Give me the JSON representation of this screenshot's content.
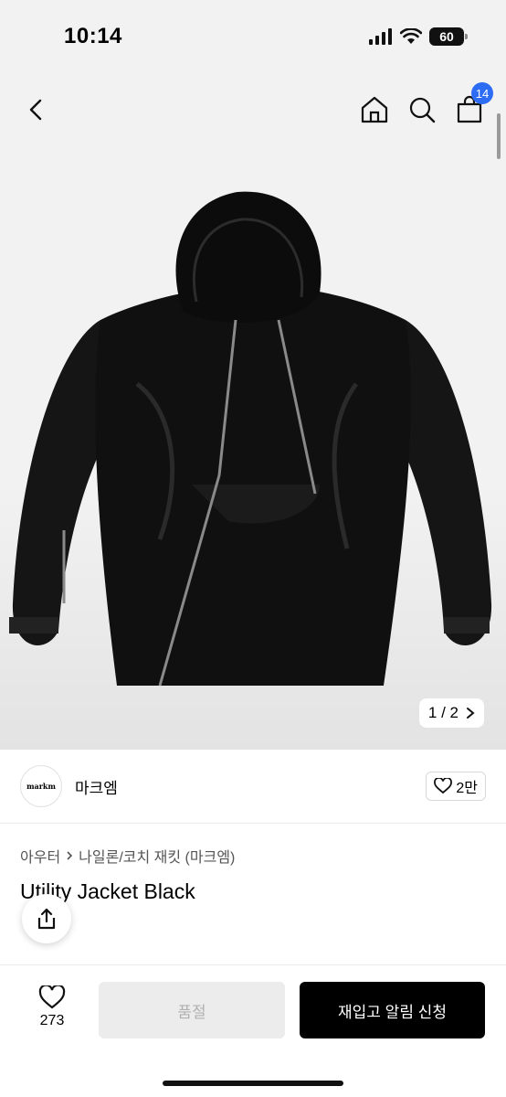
{
  "status": {
    "time": "10:14",
    "battery": "60"
  },
  "nav": {
    "cart_count": "14"
  },
  "gallery": {
    "pager": "1 / 2"
  },
  "brand": {
    "logo_text": "markm",
    "name": "마크엠",
    "likes": "2만"
  },
  "breadcrumb": {
    "category": "아우터",
    "subcategory": "나일론/코치 재킷 (마크엠)"
  },
  "product": {
    "title": "Utility Jacket Black"
  },
  "actions": {
    "wish_count": "273",
    "soldout_label": "품절",
    "restock_label": "재입고 알림 신청"
  },
  "icons": [
    "signal-icon",
    "wifi-icon",
    "battery-icon",
    "back-icon",
    "home-icon",
    "search-icon",
    "cart-icon",
    "chevron-right-icon",
    "heart-icon",
    "share-icon"
  ]
}
